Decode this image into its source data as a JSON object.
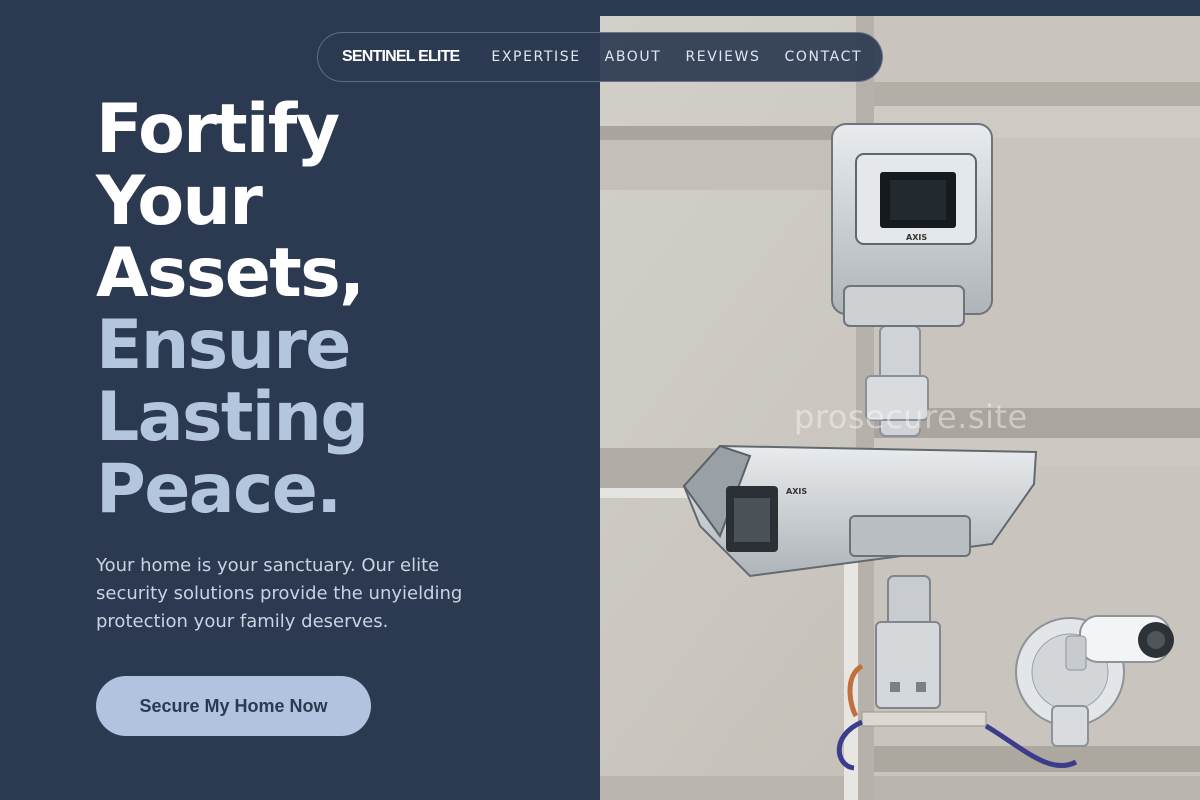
{
  "nav": {
    "brand": "SENTINEL ELITE",
    "links": [
      "EXPERTISE",
      "ABOUT",
      "REVIEWS",
      "CONTACT"
    ]
  },
  "hero": {
    "headline_lines": [
      "Fortify",
      "Your",
      "Assets,"
    ],
    "headline_accent_lines": [
      "Ensure",
      "Lasting",
      "Peace."
    ],
    "subtext": "Your home is your sanctuary. Our elite security solutions provide the unyielding protection your family deserves.",
    "cta_label": "Secure My Home Now"
  },
  "image": {
    "subject": "security-cameras-on-building-wall",
    "watermark": "prosecure.site",
    "camera_brand_text": "AXIS"
  },
  "colors": {
    "background": "#2b3a51",
    "accent_text": "#b4c5de",
    "cta_background": "#b1c3de",
    "cta_text": "#2b3a51"
  }
}
